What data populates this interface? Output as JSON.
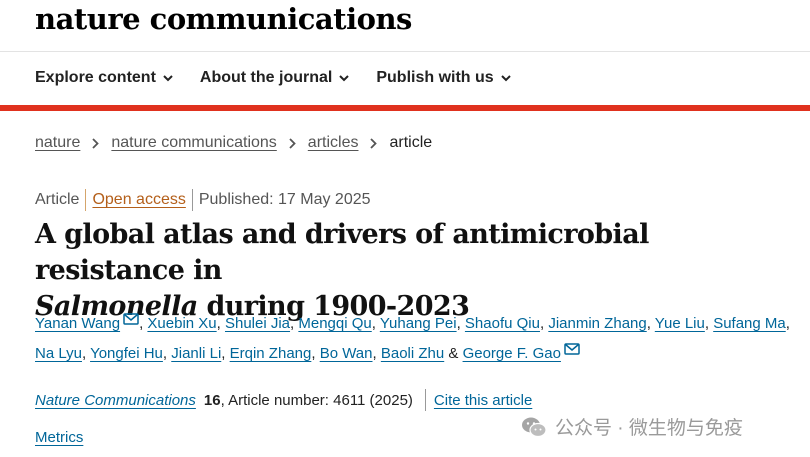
{
  "site": {
    "logo": "nature communications"
  },
  "nav": {
    "items": [
      {
        "label": "Explore content"
      },
      {
        "label": "About the journal"
      },
      {
        "label": "Publish with us"
      }
    ]
  },
  "breadcrumb": {
    "items": [
      "nature",
      "nature communications",
      "articles"
    ],
    "current": "article"
  },
  "meta": {
    "type": "Article",
    "access": "Open access",
    "published": "Published: 17 May 2025"
  },
  "title": {
    "line1": "A global atlas and drivers of antimicrobial resistance in",
    "italic": "Salmonella",
    "line2_rest": " during 1900-2023"
  },
  "authors": [
    "Yanan Wang",
    "Xuebin Xu",
    "Shulei Jia",
    "Mengqi Qu",
    "Yuhang Pei",
    "Shaofu Qiu",
    "Jianmin Zhang",
    "Yue Liu",
    "Sufang Ma",
    "Na Lyu",
    "Yongfei Hu",
    "Jianli Li",
    "Erqin Zhang",
    "Bo Wan",
    "Baoli Zhu",
    "George F. Gao"
  ],
  "citation": {
    "journal": "Nature Communications",
    "volume": "16",
    "article_number": ", Article number: 4611 (2025)",
    "cite_label": "Cite this article"
  },
  "metrics_label": "Metrics",
  "watermark": {
    "text": "公众号 · 微生物与免疫"
  },
  "colors": {
    "accent_red": "#e0311e",
    "link_blue": "#006699",
    "open_access": "#b45f1a"
  }
}
